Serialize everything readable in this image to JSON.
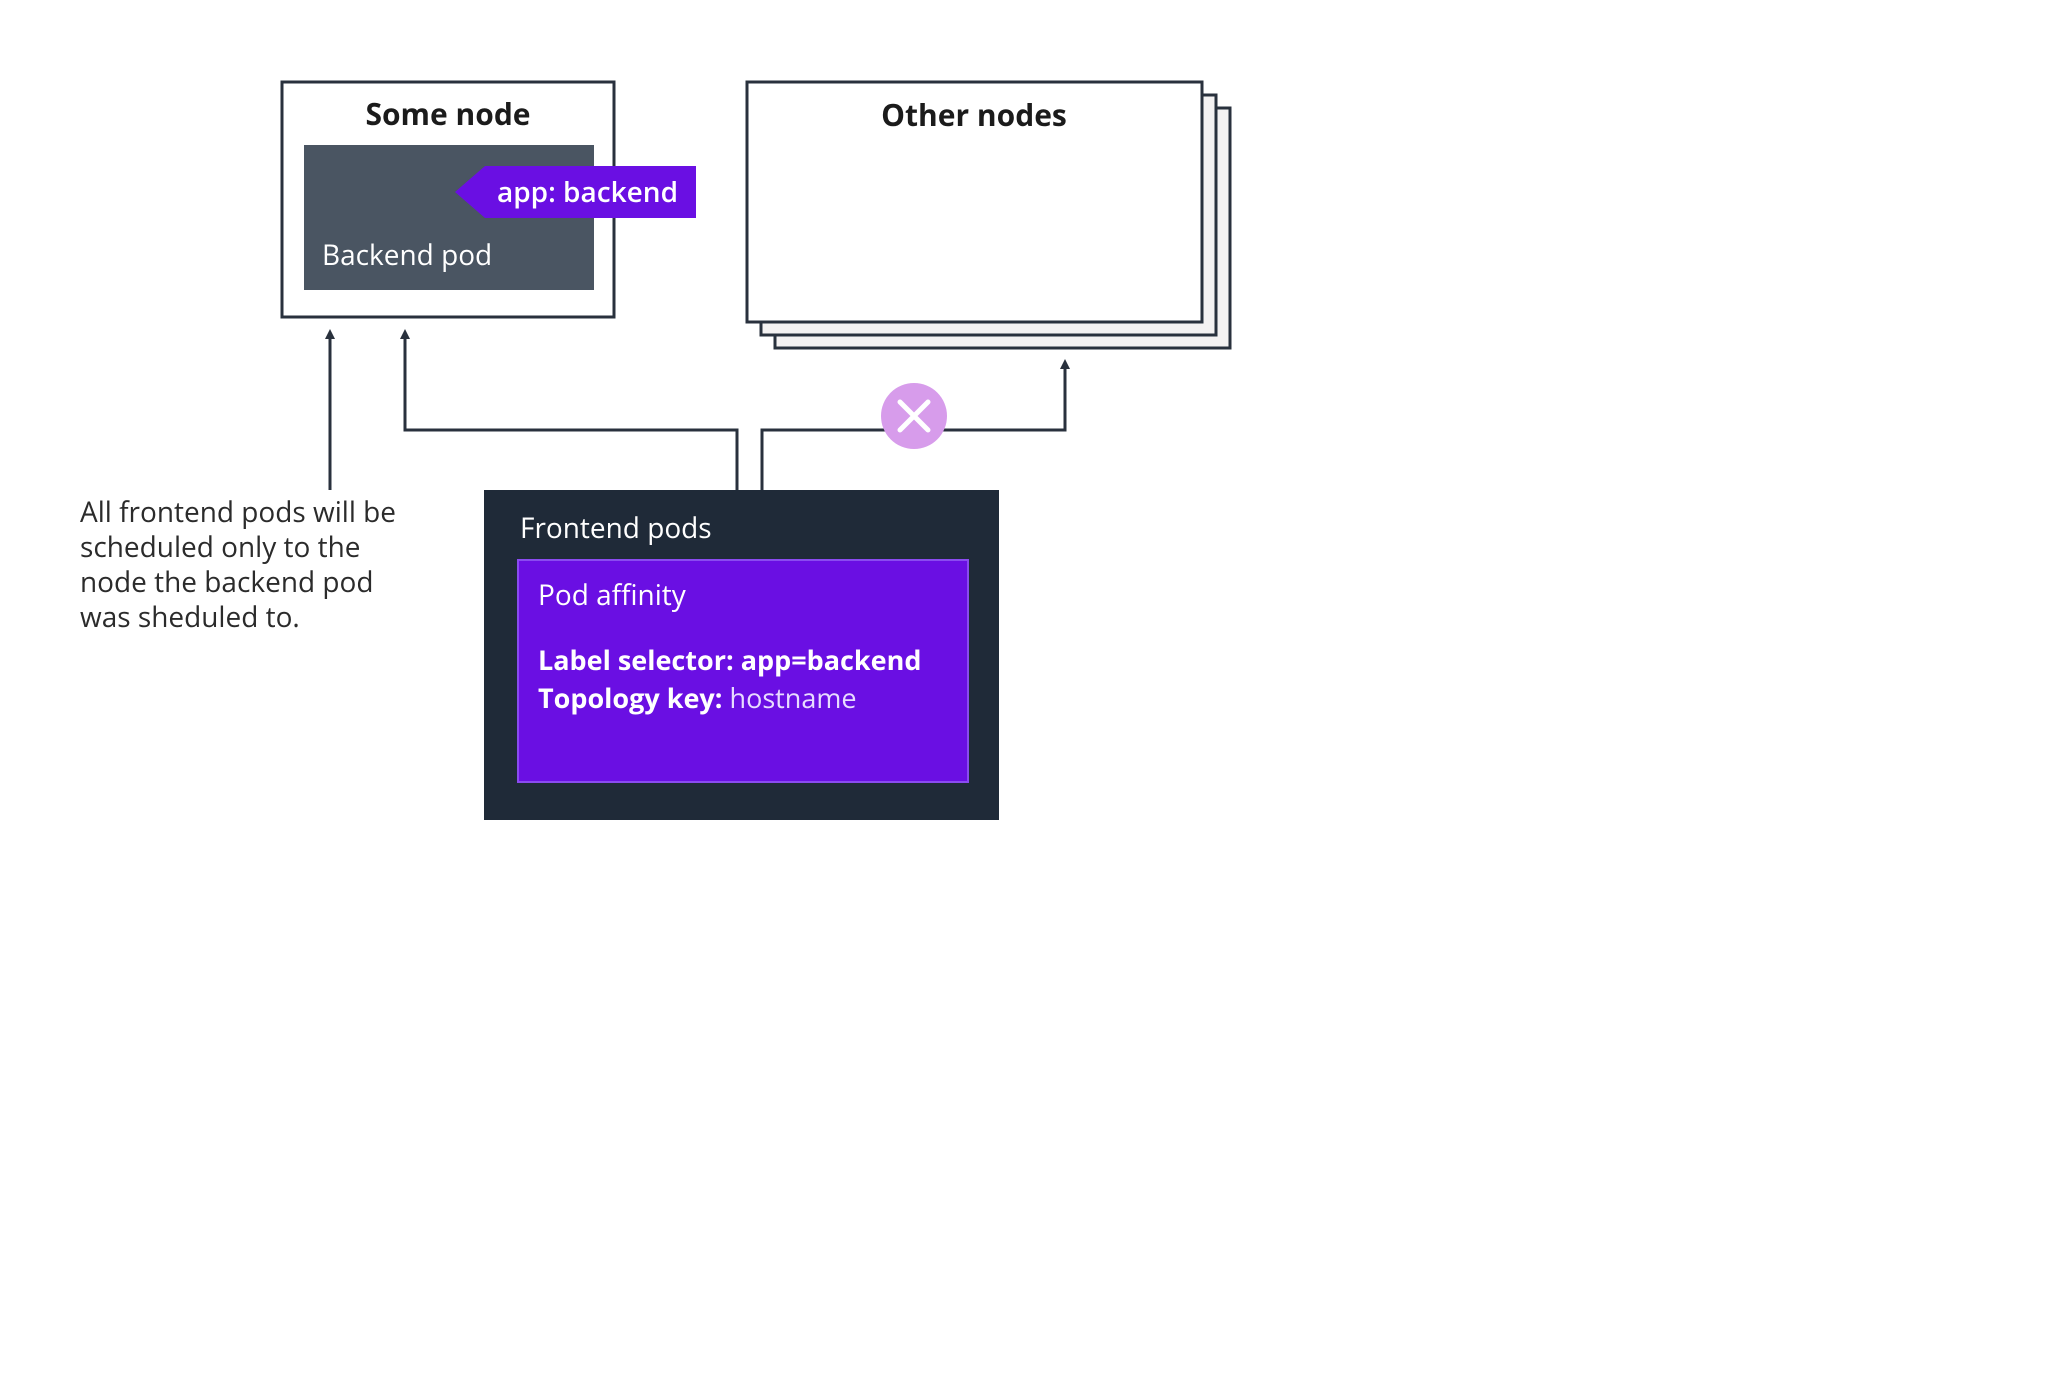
{
  "someNode": {
    "title": "Some node",
    "podLabel": "Backend pod",
    "tag": "app: backend"
  },
  "otherNodes": {
    "title": "Other nodes"
  },
  "frontend": {
    "title": "Frontend pods",
    "affinityTitle": "Pod affinity",
    "labelSelectorLabel": "Label selector: ",
    "labelSelectorValue": "app=backend",
    "topologyKeyLabel": "Topology key: ",
    "topologyKeyValue": "hostname"
  },
  "caption": {
    "line1": "All frontend pods will be",
    "line2": "scheduled only to the",
    "line3": "node the backend pod",
    "line4": "was sheduled to."
  },
  "colors": {
    "stroke": "#29313d",
    "podFill": "#4a5562",
    "frontendFill": "#1f2a38",
    "purple": "#6a0fe3",
    "offwhite": "#f4f2f2",
    "lilac": "#d79ceb"
  }
}
